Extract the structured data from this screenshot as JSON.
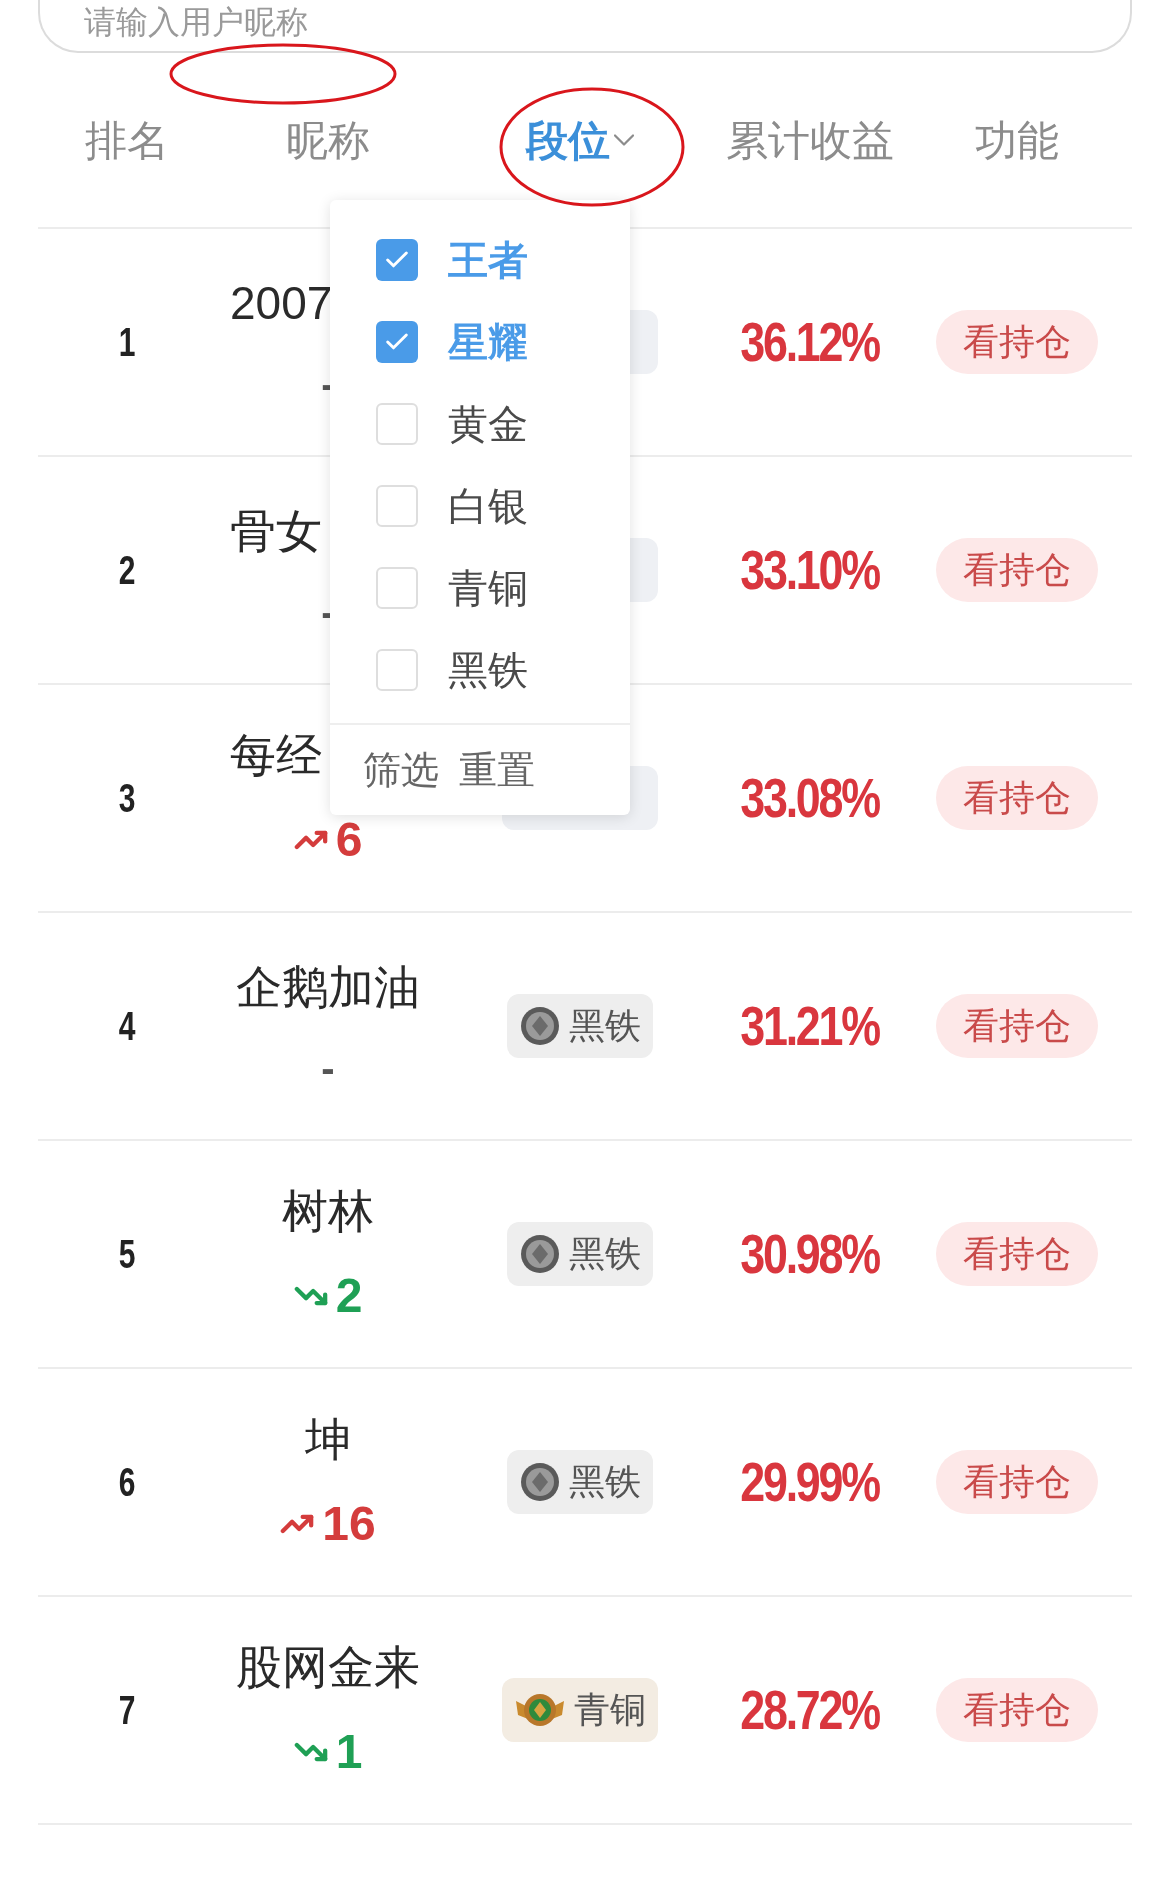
{
  "search": {
    "placeholder": "请输入用户昵称"
  },
  "columns": [
    {
      "label": "排名",
      "filter_active": false
    },
    {
      "label": "昵称",
      "filter_active": false
    },
    {
      "label": "段位",
      "filter_active": true,
      "kind": "filter"
    },
    {
      "label": "累计收益",
      "filter_active": false
    },
    {
      "label": "功能",
      "filter_active": false
    }
  ],
  "rows": [
    {
      "rank": "1",
      "name": "2007",
      "change": {
        "kind": "none",
        "value": "-"
      },
      "return": "36.12%",
      "button": "看持仓"
    },
    {
      "rank": "2",
      "name": "骨女",
      "change": {
        "kind": "none",
        "value": "-"
      },
      "return": "33.10%",
      "button": "看持仓"
    },
    {
      "rank": "3",
      "name": "每经",
      "change": {
        "kind": "up",
        "value": "6"
      },
      "return": "33.08%",
      "button": "看持仓"
    },
    {
      "rank": "4",
      "name": "企鹅加油",
      "change": {
        "kind": "none",
        "value": "-"
      },
      "tier": {
        "kind": "iron",
        "label": "黑铁"
      },
      "return": "31.21%",
      "button": "看持仓"
    },
    {
      "rank": "5",
      "name": "树林",
      "change": {
        "kind": "down",
        "value": "2"
      },
      "tier": {
        "kind": "iron",
        "label": "黑铁"
      },
      "return": "30.98%",
      "button": "看持仓"
    },
    {
      "rank": "6",
      "name": "坤",
      "change": {
        "kind": "up",
        "value": "16"
      },
      "tier": {
        "kind": "iron",
        "label": "黑铁"
      },
      "return": "29.99%",
      "button": "看持仓"
    },
    {
      "rank": "7",
      "name": "股网金来",
      "change": {
        "kind": "down",
        "value": "1"
      },
      "tier": {
        "kind": "bronze",
        "label": "青铜"
      },
      "return": "28.72%",
      "button": "看持仓"
    }
  ],
  "filter_menu": {
    "options": [
      {
        "label": "王者",
        "checked": true
      },
      {
        "label": "星耀",
        "checked": true
      },
      {
        "label": "黄金",
        "checked": false
      },
      {
        "label": "白银",
        "checked": false
      },
      {
        "label": "青铜",
        "checked": false
      },
      {
        "label": "黑铁",
        "checked": false
      }
    ],
    "actions": [
      "筛选",
      "重置"
    ]
  }
}
